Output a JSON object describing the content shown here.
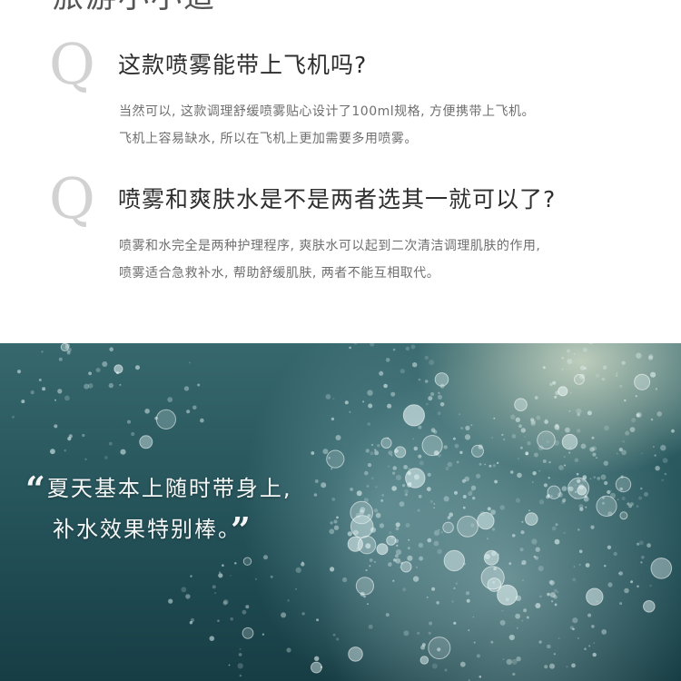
{
  "heading": {
    "text": "旅游小小道"
  },
  "qa": [
    {
      "q_letter": "Q",
      "question": "这款喷雾能带上飞机吗?",
      "answer_lines": [
        "当然可以, 这款调理舒缓喷雾贴心设计了100ml规格, 方便携带上飞机。",
        "飞机上容易缺水, 所以在飞机上更加需要多用喷雾。"
      ]
    },
    {
      "q_letter": "Q",
      "question": "喷雾和爽肤水是不是两者选其一就可以了?",
      "answer_lines": [
        "喷雾和水完全是两种护理程序, 爽肤水可以起到二次清洁调理肌肤的作用,",
        "喷雾适合急救补水, 帮助舒缓肌肤, 两者不能互相取代。"
      ]
    }
  ],
  "banner": {
    "open_quote": "“",
    "close_quote": "”",
    "line1": "夏天基本上随时带身上,",
    "line2": "补水效果特别棒。"
  },
  "colors": {
    "q_letter": "#d2d2d2",
    "question": "#2e2e2e",
    "answer": "#6f6f6f",
    "banner_water": "#2a5a60",
    "quote_text": "#f4f6f5"
  }
}
